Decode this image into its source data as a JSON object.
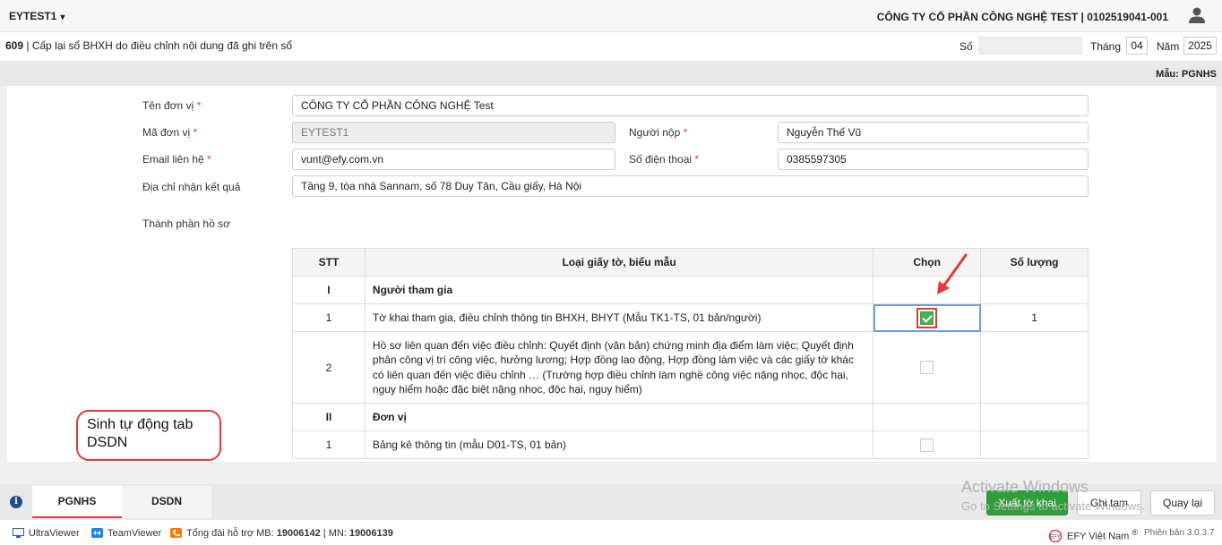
{
  "header": {
    "tenant": "EYTEST1",
    "company": "CÔNG TY CỔ PHẦN CÔNG NGHỆ TEST | 0102519041-001"
  },
  "form_title": {
    "code": "609",
    "name": " | Cấp lại sổ BHXH do điều chỉnh nội dung đã ghi trên sổ"
  },
  "period": {
    "so_label": "Số",
    "so_value": "",
    "thang_label": "Tháng",
    "thang_value": "04",
    "nam_label": "Năm",
    "nam_value": "2025"
  },
  "mau": "Mẫu: PGNHS",
  "fields": {
    "ten_don_vi": {
      "label": "Tên đơn vị",
      "value": "CÔNG TY CỔ PHẦN CÔNG NGHỆ Test"
    },
    "ma_don_vi": {
      "label": "Mã đơn vị",
      "value": "EYTEST1"
    },
    "nguoi_nop": {
      "label": "Người nộp",
      "value": "Nguyễn Thế Vũ"
    },
    "email": {
      "label": "Email liên hệ",
      "value": "vunt@efy.com.vn"
    },
    "so_dien_thoai": {
      "label": "Số điện thoại",
      "value": "0385597305"
    },
    "dia_chi": {
      "label": "Địa chỉ nhận kết quả",
      "value": "Tầng 9, tòa nhà Sannam, số 78 Duy Tân, Cầu giấy, Hà Nội"
    },
    "thanh_phan": {
      "label": "Thành phần hồ sơ"
    }
  },
  "table": {
    "headers": [
      "STT",
      "Loại giấy tờ, biểu mẫu",
      "Chọn",
      "Số lượng"
    ],
    "rows": [
      {
        "stt": "I",
        "name": "Người tham gia",
        "group": true
      },
      {
        "stt": "1",
        "name": "Tờ khai tham gia, điều chỉnh thông tin BHXH, BHYT (Mẫu TK1-TS, 01 bản/người)",
        "checked": true,
        "qty": "1"
      },
      {
        "stt": "2",
        "name": "Hồ sơ liên quan đến việc điều chỉnh: Quyết định (văn bản) chứng minh địa điểm làm việc; Quyết định phân công vị trí công việc, hưởng lương; Hợp đồng lao động, Hợp đồng làm việc và các giấy tờ khác có liên quan đến việc điều chỉnh … (Trường hợp điều chỉnh làm nghề công việc nặng nhọc, độc hại, nguy hiểm hoặc đặc biệt nặng nhọc, độc hại, nguy hiểm)",
        "checked": false,
        "qty": ""
      },
      {
        "stt": "II",
        "name": "Đơn vị",
        "group": true
      },
      {
        "stt": "1",
        "name": "Bảng kê thông tin (mẫu D01-TS, 01 bản)",
        "checked": false,
        "qty": ""
      }
    ]
  },
  "tabs": [
    "PGNHS",
    "DSDN"
  ],
  "buttons": {
    "export": "Xuất tờ khai",
    "draft": "Ghi tạm",
    "back": "Quay lại"
  },
  "watermark": {
    "line1": "Activate Windows",
    "line2": "Go to Settings to activate Windows."
  },
  "callout": "Sinh tự động tab DSDN",
  "footer": {
    "ultraviewer": "UltraViewer",
    "teamviewer": "TeamViewer",
    "hotline_prefix": "Tổng đài hỗ trợ MB: ",
    "hotline_mb": "19006142",
    "hotline_sep": " | MN: ",
    "hotline_mn": "19006139",
    "brand": "EFY Việt Nam",
    "brand_mark": "®",
    "version": "Phiên bản 3.0.3.7"
  },
  "colors": {
    "accent_red": "#e53935",
    "green": "#2e9e3b",
    "navy": "#1e4e8c"
  }
}
